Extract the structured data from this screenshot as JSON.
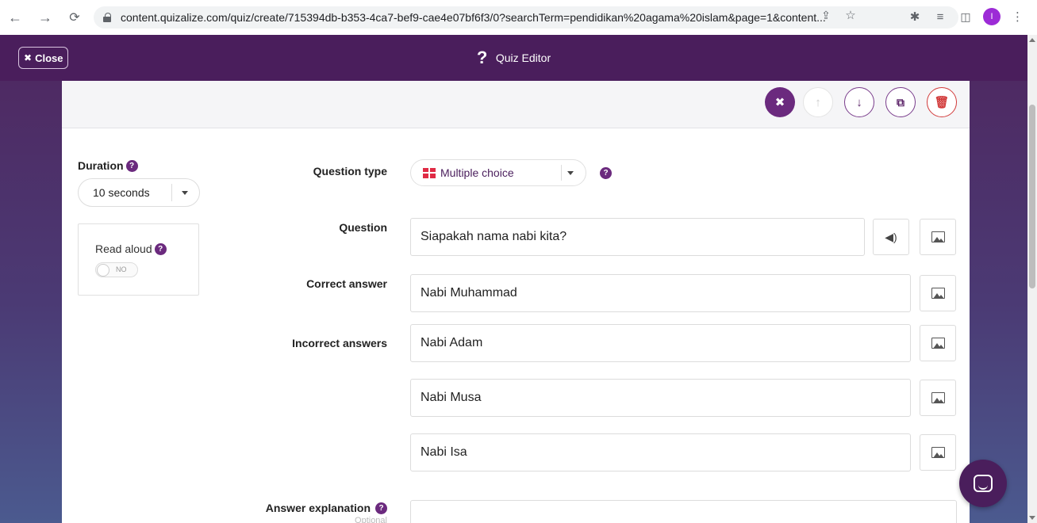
{
  "browser": {
    "url": "content.quizalize.com/quiz/create/715394db-b353-4ca7-bef9-cae4e07bf6f3/0?searchTerm=pendidikan%20agama%20islam&page=1&content...",
    "profile_initial": "I"
  },
  "app_bar": {
    "close_label": "Close",
    "title": "Quiz Editor"
  },
  "card": {
    "duration_label": "Duration",
    "duration_value": "10 seconds",
    "read_aloud_label": "Read aloud",
    "read_aloud_state": "NO",
    "question_type_label": "Question type",
    "question_type_value": "Multiple choice",
    "question_label": "Question",
    "question_value": "Siapakah nama nabi kita?",
    "correct_label": "Correct answer",
    "correct_value": "Nabi Muhammad",
    "incorrect_label": "Incorrect answers",
    "incorrect_values": [
      "Nabi Adam",
      "Nabi Musa",
      "Nabi Isa"
    ],
    "explanation_label": "Answer explanation",
    "explanation_optional": "Optional"
  },
  "colors": {
    "brand": "#4a1e5c",
    "accent": "#6b2a7e",
    "danger": "#d23b3b",
    "grid_icon": "#e02b45"
  }
}
